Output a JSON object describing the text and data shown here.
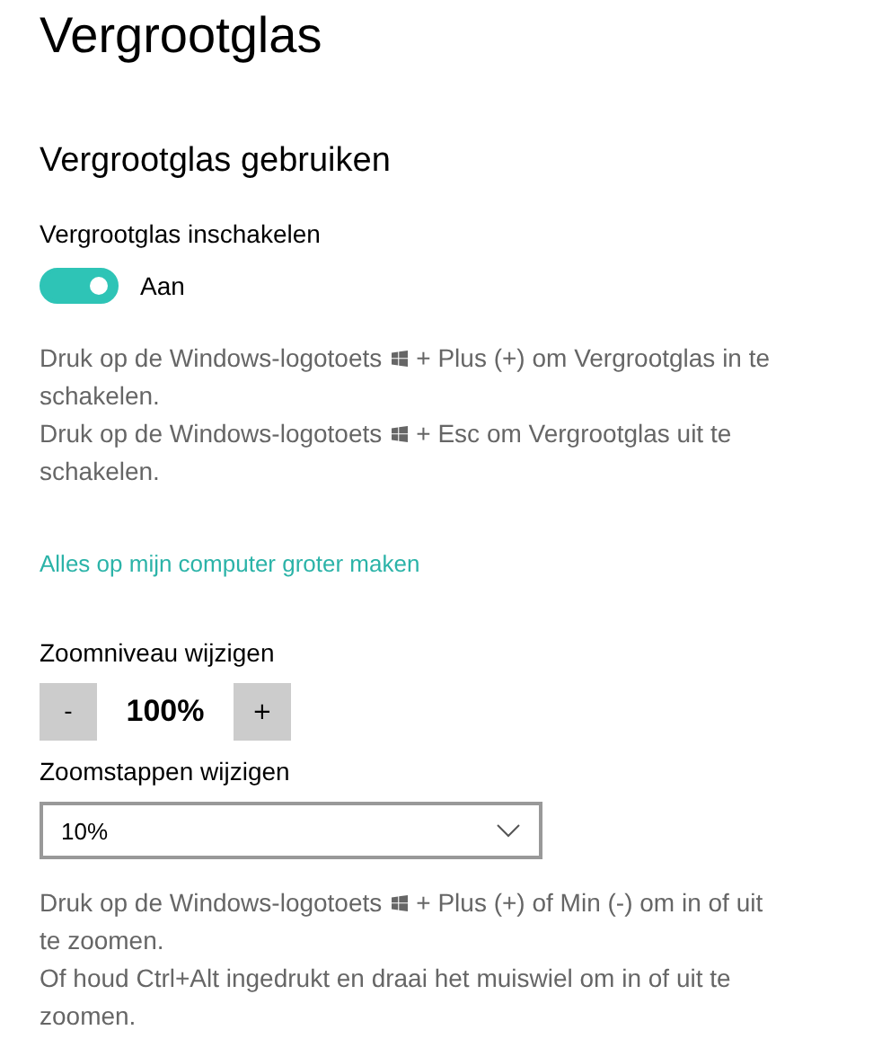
{
  "title": "Vergrootglas",
  "section": "Vergrootglas gebruiken",
  "toggle": {
    "label": "Vergrootglas inschakelen",
    "on": true,
    "state_text": "Aan"
  },
  "shortcuts": [
    {
      "before": "Druk op de Windows-logotoets",
      "after": "+ Plus (+) om Vergrootglas in te"
    },
    {
      "after": "schakelen."
    },
    {
      "before": "Druk op de Windows-logotoets",
      "after": "+ Esc om Vergrootglas uit te"
    },
    {
      "after": "schakelen."
    }
  ],
  "link": "Alles op mijn computer groter maken",
  "zoom": {
    "label": "Zoomniveau wijzigen",
    "minus": "-",
    "value": "100%",
    "plus": "+"
  },
  "steps": {
    "label": "Zoomstappen wijzigen",
    "value": "10%"
  },
  "zoom_help": [
    {
      "before": "Druk op de Windows-logotoets",
      "after": "+ Plus (+) of Min (-) om in of uit"
    },
    {
      "after": "te zoomen."
    },
    {
      "after": "Of houd Ctrl+Alt ingedrukt en draai het muiswiel om in of uit te"
    },
    {
      "after": "zoomen."
    }
  ]
}
